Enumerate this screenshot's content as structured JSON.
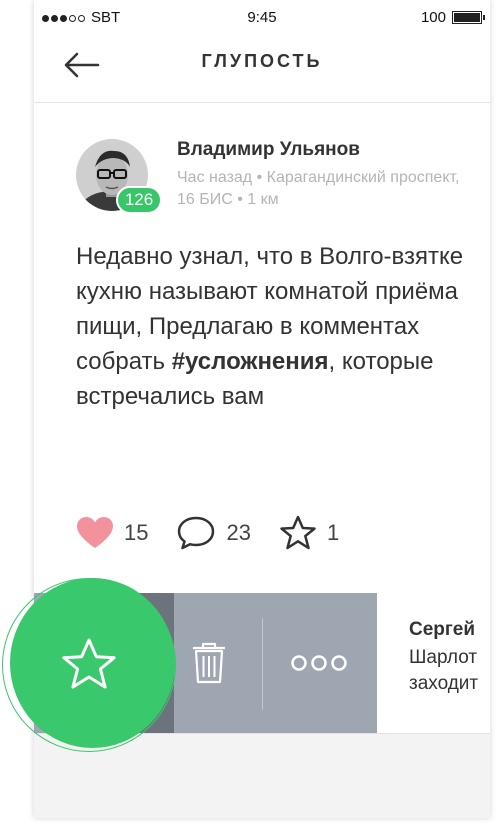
{
  "status_bar": {
    "carrier": "SBT",
    "time": "9:45",
    "battery": "100",
    "battery_level": 1.0
  },
  "nav": {
    "title": "ГЛУПОСТЬ",
    "back_icon": "arrow-left-icon"
  },
  "post": {
    "author": "Владимир Ульянов",
    "meta": "Час назад • Карагандинский проспект, 16 БИС • 1 км",
    "badge": "126",
    "text_before": "Недавно узнал, что в Волго-взятке кухню называют комнатой приёма пищи, Предлагаю в комментах собрать ",
    "hashtag": "#усложнения",
    "text_after": ", которые встречались вам",
    "likes": "15",
    "comments": "23",
    "favorites": "1"
  },
  "swipe": {
    "next_author": "Сергей",
    "next_text_line1": "Шарлот",
    "next_text_line2": "заходит"
  },
  "colors": {
    "accent": "#39c86c",
    "like": "#f2929c",
    "swipe_bg": "#9ea6b1",
    "swipe_dark": "#6c737c"
  }
}
